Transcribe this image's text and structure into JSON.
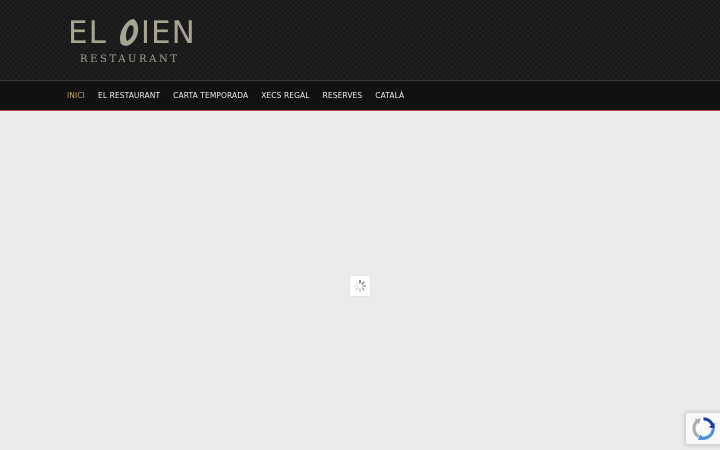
{
  "brand": {
    "name_left": "EL",
    "name_right": "IEN",
    "subtitle": "RESTAURANT",
    "logo_color": "#a7a591"
  },
  "nav": {
    "items": [
      {
        "label": "INICI",
        "active": true
      },
      {
        "label": "EL RESTAURANT",
        "active": false
      },
      {
        "label": "CARTA TEMPORADA",
        "active": false
      },
      {
        "label": "XECS REGAL",
        "active": false
      },
      {
        "label": "RESERVES",
        "active": false
      },
      {
        "label": "CATALÀ",
        "active": false
      }
    ],
    "active_color": "#c5a95a",
    "underline_color": "#b84a52"
  },
  "content": {
    "loader_icon": "spinner-icon",
    "background": "#ebebeb"
  },
  "recaptcha": {
    "icon": "recaptcha-icon"
  }
}
